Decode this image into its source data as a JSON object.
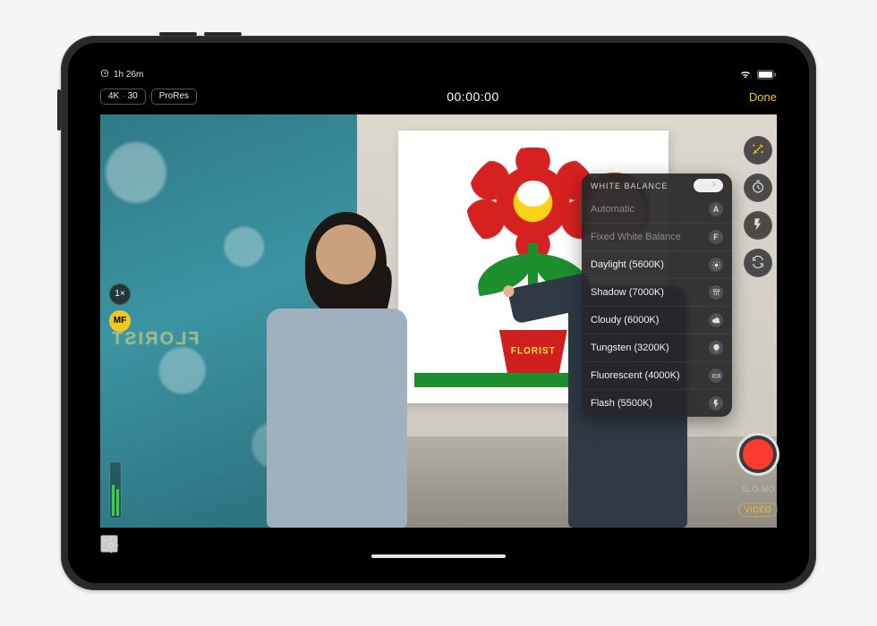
{
  "status": {
    "time_remaining": "1h 26m"
  },
  "topbar": {
    "resolution": "4K",
    "framerate": "30",
    "codec": "ProRes",
    "timecode": "00:00:00",
    "done_label": "Done"
  },
  "viewfinder": {
    "zoom_label": "1×",
    "focus_mode": "MF",
    "mirror_sign": "FLORIST",
    "poster_pot_label": "FLORIST"
  },
  "white_balance": {
    "title": "WHITE BALANCE",
    "more_label": "···",
    "items": [
      {
        "label": "Automatic",
        "badge": "A",
        "dim": true
      },
      {
        "label": "Fixed White Balance",
        "badge": "F",
        "dim": true
      },
      {
        "label": "Daylight (5600K)",
        "badge": "sun",
        "dim": false
      },
      {
        "label": "Shadow (7000K)",
        "badge": "shade",
        "dim": false
      },
      {
        "label": "Cloudy (6000K)",
        "badge": "cloud",
        "dim": false
      },
      {
        "label": "Tungsten (3200K)",
        "badge": "bulb",
        "dim": false
      },
      {
        "label": "Fluorescent (4000K)",
        "badge": "tube",
        "dim": false
      },
      {
        "label": "Flash (5500K)",
        "badge": "flash",
        "dim": false
      }
    ]
  },
  "right_controls": {
    "tools": [
      {
        "name": "wand-icon",
        "active": true
      },
      {
        "name": "timer-icon",
        "active": false
      },
      {
        "name": "flash-icon",
        "active": false
      },
      {
        "name": "flip-camera-icon",
        "active": false
      }
    ],
    "modes": {
      "slo_mo": "SLO-MO",
      "video": "VIDEO"
    }
  }
}
